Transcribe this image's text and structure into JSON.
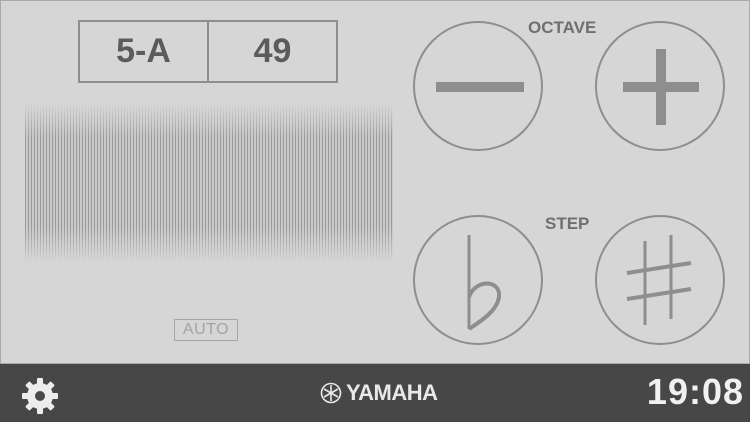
{
  "display": {
    "note": "5-A",
    "number": "49",
    "mode_badge": "AUTO"
  },
  "octave": {
    "label": "OCTAVE",
    "minus": "minus-icon",
    "plus": "plus-icon"
  },
  "step": {
    "label": "STEP",
    "flat": "flat-icon",
    "sharp": "sharp-icon"
  },
  "footer": {
    "brand": "YAMAHA",
    "time": "19:08",
    "settings": "gear-icon"
  },
  "colors": {
    "background": "#d6d6d6",
    "stroke": "#8e8e8e",
    "footer": "#474747"
  }
}
